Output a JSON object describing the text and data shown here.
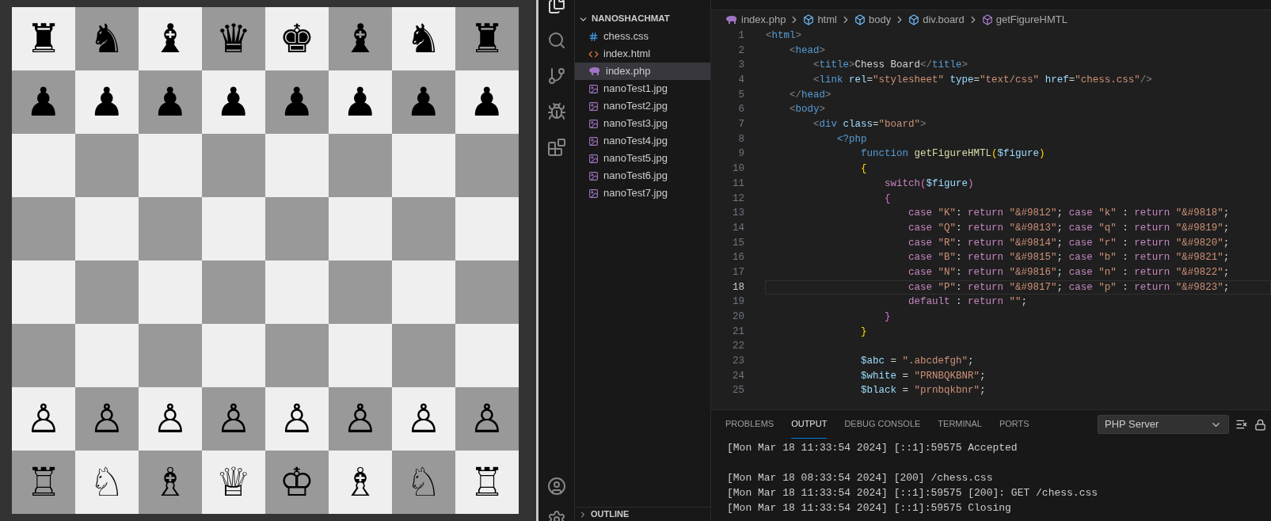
{
  "board": {
    "ranks": [
      {
        "squares": [
          {
            "color": "#efefef",
            "piece": "♜"
          },
          {
            "color": "#999999",
            "piece": "♞"
          },
          {
            "color": "#efefef",
            "piece": "♝"
          },
          {
            "color": "#999999",
            "piece": "♛"
          },
          {
            "color": "#efefef",
            "piece": "♚"
          },
          {
            "color": "#999999",
            "piece": "♝"
          },
          {
            "color": "#efefef",
            "piece": "♞"
          },
          {
            "color": "#999999",
            "piece": "♜"
          }
        ]
      },
      {
        "squares": [
          {
            "color": "#999999",
            "piece": "♟"
          },
          {
            "color": "#efefef",
            "piece": "♟"
          },
          {
            "color": "#999999",
            "piece": "♟"
          },
          {
            "color": "#efefef",
            "piece": "♟"
          },
          {
            "color": "#999999",
            "piece": "♟"
          },
          {
            "color": "#efefef",
            "piece": "♟"
          },
          {
            "color": "#999999",
            "piece": "♟"
          },
          {
            "color": "#efefef",
            "piece": "♟"
          }
        ]
      },
      {
        "squares": [
          {
            "color": "#efefef"
          },
          {
            "color": "#999999"
          },
          {
            "color": "#efefef"
          },
          {
            "color": "#999999"
          },
          {
            "color": "#efefef"
          },
          {
            "color": "#999999"
          },
          {
            "color": "#efefef"
          },
          {
            "color": "#999999"
          }
        ]
      },
      {
        "squares": [
          {
            "color": "#999999"
          },
          {
            "color": "#efefef"
          },
          {
            "color": "#999999"
          },
          {
            "color": "#efefef"
          },
          {
            "color": "#999999"
          },
          {
            "color": "#efefef"
          },
          {
            "color": "#999999"
          },
          {
            "color": "#efefef"
          }
        ]
      },
      {
        "squares": [
          {
            "color": "#efefef"
          },
          {
            "color": "#999999"
          },
          {
            "color": "#efefef"
          },
          {
            "color": "#999999"
          },
          {
            "color": "#efefef"
          },
          {
            "color": "#999999"
          },
          {
            "color": "#efefef"
          },
          {
            "color": "#999999"
          }
        ]
      },
      {
        "squares": [
          {
            "color": "#999999"
          },
          {
            "color": "#efefef"
          },
          {
            "color": "#999999"
          },
          {
            "color": "#efefef"
          },
          {
            "color": "#999999"
          },
          {
            "color": "#efefef"
          },
          {
            "color": "#999999"
          },
          {
            "color": "#efefef"
          }
        ]
      },
      {
        "squares": [
          {
            "color": "#efefef",
            "piece": "♙"
          },
          {
            "color": "#999999",
            "piece": "♙"
          },
          {
            "color": "#efefef",
            "piece": "♙"
          },
          {
            "color": "#999999",
            "piece": "♙"
          },
          {
            "color": "#efefef",
            "piece": "♙"
          },
          {
            "color": "#999999",
            "piece": "♙"
          },
          {
            "color": "#efefef",
            "piece": "♙"
          },
          {
            "color": "#999999",
            "piece": "♙"
          }
        ]
      },
      {
        "squares": [
          {
            "color": "#999999",
            "piece": "♖"
          },
          {
            "color": "#efefef",
            "piece": "♘"
          },
          {
            "color": "#999999",
            "piece": "♗"
          },
          {
            "color": "#efefef",
            "piece": "♕"
          },
          {
            "color": "#999999",
            "piece": "♔"
          },
          {
            "color": "#efefef",
            "piece": "♗"
          },
          {
            "color": "#999999",
            "piece": "♘"
          },
          {
            "color": "#efefef",
            "piece": "♖"
          }
        ]
      }
    ]
  },
  "explorer": {
    "folder": {
      "name": "NANOSHACHMAT",
      "expanded": true
    },
    "files": [
      {
        "name": "chess.css",
        "kind": "css",
        "selected": false
      },
      {
        "name": "index.html",
        "kind": "html",
        "selected": false
      },
      {
        "name": "index.php",
        "kind": "php",
        "selected": true
      },
      {
        "name": "nanoTest1.jpg",
        "kind": "image",
        "selected": false
      },
      {
        "name": "nanoTest2.jpg",
        "kind": "image",
        "selected": false
      },
      {
        "name": "nanoTest3.jpg",
        "kind": "image",
        "selected": false
      },
      {
        "name": "nanoTest4.jpg",
        "kind": "image",
        "selected": false
      },
      {
        "name": "nanoTest5.jpg",
        "kind": "image",
        "selected": false
      },
      {
        "name": "nanoTest6.jpg",
        "kind": "image",
        "selected": false
      },
      {
        "name": "nanoTest7.jpg",
        "kind": "image",
        "selected": false
      }
    ],
    "outline": {
      "label": "OUTLINE",
      "expanded": false
    }
  },
  "breadcrumb": [
    {
      "label": "index.php",
      "kind": "file"
    },
    {
      "label": "html",
      "kind": "element"
    },
    {
      "label": "body",
      "kind": "element"
    },
    {
      "label": "div.board",
      "kind": "element"
    },
    {
      "label": "getFigureHMTL",
      "kind": "function"
    }
  ],
  "code": [
    {
      "number": "1",
      "current": false,
      "tokens": [
        {
          "kind": "p",
          "text": "<"
        },
        {
          "kind": "tag",
          "text": "html"
        },
        {
          "kind": "p",
          "text": ">"
        }
      ]
    },
    {
      "number": "2",
      "current": false,
      "tokens": [
        {
          "kind": "p",
          "text": "    <"
        },
        {
          "kind": "tag",
          "text": "head"
        },
        {
          "kind": "p",
          "text": ">"
        }
      ]
    },
    {
      "number": "3",
      "current": false,
      "tokens": [
        {
          "kind": "p",
          "text": "        <"
        },
        {
          "kind": "tag",
          "text": "title"
        },
        {
          "kind": "p",
          "text": ">"
        },
        {
          "kind": "txt",
          "text": "Chess Board"
        },
        {
          "kind": "p",
          "text": "</"
        },
        {
          "kind": "tag",
          "text": "title"
        },
        {
          "kind": "p",
          "text": ">"
        }
      ]
    },
    {
      "number": "4",
      "current": false,
      "tokens": [
        {
          "kind": "p",
          "text": "        <"
        },
        {
          "kind": "tag",
          "text": "link"
        },
        {
          "kind": "attr",
          "text": " rel"
        },
        {
          "kind": "txt",
          "text": "="
        },
        {
          "kind": "str",
          "text": "\"stylesheet\""
        },
        {
          "kind": "attr",
          "text": " type"
        },
        {
          "kind": "txt",
          "text": "="
        },
        {
          "kind": "str",
          "text": "\"text/css\""
        },
        {
          "kind": "attr",
          "text": " href"
        },
        {
          "kind": "txt",
          "text": "="
        },
        {
          "kind": "str",
          "text": "\"chess.css\""
        },
        {
          "kind": "p",
          "text": "/>"
        }
      ]
    },
    {
      "number": "5",
      "current": false,
      "tokens": [
        {
          "kind": "p",
          "text": "    </"
        },
        {
          "kind": "tag",
          "text": "head"
        },
        {
          "kind": "p",
          "text": ">"
        }
      ]
    },
    {
      "number": "6",
      "current": false,
      "tokens": [
        {
          "kind": "p",
          "text": "    <"
        },
        {
          "kind": "tag",
          "text": "body"
        },
        {
          "kind": "p",
          "text": ">"
        }
      ]
    },
    {
      "number": "7",
      "current": false,
      "tokens": [
        {
          "kind": "p",
          "text": "        <"
        },
        {
          "kind": "tag",
          "text": "div"
        },
        {
          "kind": "attr",
          "text": " class"
        },
        {
          "kind": "txt",
          "text": "="
        },
        {
          "kind": "str",
          "text": "\"board\""
        },
        {
          "kind": "p",
          "text": ">"
        }
      ]
    },
    {
      "number": "8",
      "current": false,
      "tokens": [
        {
          "kind": "tag",
          "text": "            <?php"
        }
      ]
    },
    {
      "number": "9",
      "current": false,
      "tokens": [
        {
          "kind": "decl",
          "text": "                function"
        },
        {
          "kind": "fn",
          "text": " getFigureHMTL"
        },
        {
          "kind": "brace",
          "text": "("
        },
        {
          "kind": "var",
          "text": "$figure"
        },
        {
          "kind": "brace",
          "text": ")"
        }
      ]
    },
    {
      "number": "10",
      "current": false,
      "tokens": [
        {
          "kind": "brace",
          "text": "                {"
        }
      ]
    },
    {
      "number": "11",
      "current": false,
      "tokens": [
        {
          "kind": "kw",
          "text": "                    switch"
        },
        {
          "kind": "brace2",
          "text": "("
        },
        {
          "kind": "var",
          "text": "$figure"
        },
        {
          "kind": "brace2",
          "text": ")"
        }
      ]
    },
    {
      "number": "12",
      "current": false,
      "tokens": [
        {
          "kind": "brace2",
          "text": "                    {"
        }
      ]
    },
    {
      "number": "13",
      "current": false,
      "tokens": [
        {
          "kind": "kw",
          "text": "                        case"
        },
        {
          "kind": "str",
          "text": " \"K\""
        },
        {
          "kind": "txt",
          "text": ": "
        },
        {
          "kind": "kw",
          "text": "return"
        },
        {
          "kind": "str",
          "text": " \"&#9812\""
        },
        {
          "kind": "txt",
          "text": "; "
        },
        {
          "kind": "kw",
          "text": "case"
        },
        {
          "kind": "str",
          "text": " \"k\""
        },
        {
          "kind": "txt",
          "text": " : "
        },
        {
          "kind": "kw",
          "text": "return"
        },
        {
          "kind": "str",
          "text": " \"&#9818\""
        },
        {
          "kind": "txt",
          "text": ";"
        }
      ]
    },
    {
      "number": "14",
      "current": false,
      "tokens": [
        {
          "kind": "kw",
          "text": "                        case"
        },
        {
          "kind": "str",
          "text": " \"Q\""
        },
        {
          "kind": "txt",
          "text": ": "
        },
        {
          "kind": "kw",
          "text": "return"
        },
        {
          "kind": "str",
          "text": " \"&#9813\""
        },
        {
          "kind": "txt",
          "text": "; "
        },
        {
          "kind": "kw",
          "text": "case"
        },
        {
          "kind": "str",
          "text": " \"q\""
        },
        {
          "kind": "txt",
          "text": " : "
        },
        {
          "kind": "kw",
          "text": "return"
        },
        {
          "kind": "str",
          "text": " \"&#9819\""
        },
        {
          "kind": "txt",
          "text": ";"
        }
      ]
    },
    {
      "number": "15",
      "current": false,
      "tokens": [
        {
          "kind": "kw",
          "text": "                        case"
        },
        {
          "kind": "str",
          "text": " \"R\""
        },
        {
          "kind": "txt",
          "text": ": "
        },
        {
          "kind": "kw",
          "text": "return"
        },
        {
          "kind": "str",
          "text": " \"&#9814\""
        },
        {
          "kind": "txt",
          "text": "; "
        },
        {
          "kind": "kw",
          "text": "case"
        },
        {
          "kind": "str",
          "text": " \"r\""
        },
        {
          "kind": "txt",
          "text": " : "
        },
        {
          "kind": "kw",
          "text": "return"
        },
        {
          "kind": "str",
          "text": " \"&#9820\""
        },
        {
          "kind": "txt",
          "text": ";"
        }
      ]
    },
    {
      "number": "16",
      "current": false,
      "tokens": [
        {
          "kind": "kw",
          "text": "                        case"
        },
        {
          "kind": "str",
          "text": " \"B\""
        },
        {
          "kind": "txt",
          "text": ": "
        },
        {
          "kind": "kw",
          "text": "return"
        },
        {
          "kind": "str",
          "text": " \"&#9815\""
        },
        {
          "kind": "txt",
          "text": "; "
        },
        {
          "kind": "kw",
          "text": "case"
        },
        {
          "kind": "str",
          "text": " \"b\""
        },
        {
          "kind": "txt",
          "text": " : "
        },
        {
          "kind": "kw",
          "text": "return"
        },
        {
          "kind": "str",
          "text": " \"&#9821\""
        },
        {
          "kind": "txt",
          "text": ";"
        }
      ]
    },
    {
      "number": "17",
      "current": false,
      "tokens": [
        {
          "kind": "kw",
          "text": "                        case"
        },
        {
          "kind": "str",
          "text": " \"N\""
        },
        {
          "kind": "txt",
          "text": ": "
        },
        {
          "kind": "kw",
          "text": "return"
        },
        {
          "kind": "str",
          "text": " \"&#9816\""
        },
        {
          "kind": "txt",
          "text": "; "
        },
        {
          "kind": "kw",
          "text": "case"
        },
        {
          "kind": "str",
          "text": " \"n\""
        },
        {
          "kind": "txt",
          "text": " : "
        },
        {
          "kind": "kw",
          "text": "return"
        },
        {
          "kind": "str",
          "text": " \"&#9822\""
        },
        {
          "kind": "txt",
          "text": ";"
        }
      ]
    },
    {
      "number": "18",
      "current": true,
      "tokens": [
        {
          "kind": "kw",
          "text": "                        case"
        },
        {
          "kind": "str",
          "text": " \"P\""
        },
        {
          "kind": "txt",
          "text": ": "
        },
        {
          "kind": "kw",
          "text": "return"
        },
        {
          "kind": "str",
          "text": " \"&#9817\""
        },
        {
          "kind": "txt",
          "text": "; "
        },
        {
          "kind": "kw",
          "text": "case"
        },
        {
          "kind": "str",
          "text": " \"p\""
        },
        {
          "kind": "txt",
          "text": " : "
        },
        {
          "kind": "kw",
          "text": "return"
        },
        {
          "kind": "str",
          "text": " \"&#9823\""
        },
        {
          "kind": "txt",
          "text": ";"
        }
      ]
    },
    {
      "number": "19",
      "current": false,
      "tokens": [
        {
          "kind": "kw",
          "text": "                        default"
        },
        {
          "kind": "txt",
          "text": " : "
        },
        {
          "kind": "kw",
          "text": "return"
        },
        {
          "kind": "str",
          "text": " \"\""
        },
        {
          "kind": "txt",
          "text": ";"
        }
      ]
    },
    {
      "number": "20",
      "current": false,
      "tokens": [
        {
          "kind": "brace2",
          "text": "                    }"
        }
      ]
    },
    {
      "number": "21",
      "current": false,
      "tokens": [
        {
          "kind": "brace",
          "text": "                }"
        }
      ]
    },
    {
      "number": "22",
      "current": false
    },
    {
      "number": "23",
      "current": false,
      "tokens": [
        {
          "kind": "var",
          "text": "                $abc"
        },
        {
          "kind": "txt",
          "text": " = "
        },
        {
          "kind": "str",
          "text": "\".abcdefgh\""
        },
        {
          "kind": "txt",
          "text": ";"
        }
      ]
    },
    {
      "number": "24",
      "current": false,
      "tokens": [
        {
          "kind": "var",
          "text": "                $white"
        },
        {
          "kind": "txt",
          "text": " = "
        },
        {
          "kind": "str",
          "text": "\"PRNBQKBNR\""
        },
        {
          "kind": "txt",
          "text": ";"
        }
      ]
    },
    {
      "number": "25",
      "current": false,
      "tokens": [
        {
          "kind": "var",
          "text": "                $black"
        },
        {
          "kind": "txt",
          "text": " = "
        },
        {
          "kind": "str",
          "text": "\"prnbqkbnr\""
        },
        {
          "kind": "txt",
          "text": ";"
        }
      ]
    }
  ],
  "panel": {
    "tabs": [
      {
        "label": "PROBLEMS",
        "selected": false
      },
      {
        "label": "OUTPUT",
        "selected": true
      },
      {
        "label": "DEBUG CONSOLE",
        "selected": false
      },
      {
        "label": "TERMINAL",
        "selected": false
      },
      {
        "label": "PORTS",
        "selected": false
      }
    ],
    "channel": "PHP Server",
    "output": [
      {
        "kind": "line",
        "text": "[Mon Mar 18 11:33:54 2024] [::1]:59575 Accepted"
      },
      {
        "kind": "blank"
      },
      {
        "kind": "line",
        "text": "[Mon Mar 18 08:33:54 2024] [200] /chess.css"
      },
      {
        "kind": "line",
        "text": "[Mon Mar 18 11:33:54 2024] [::1]:59575 [200]: GET /chess.css"
      },
      {
        "kind": "line",
        "text": "[Mon Mar 18 11:33:54 2024] [::1]:59575 Closing"
      }
    ]
  }
}
